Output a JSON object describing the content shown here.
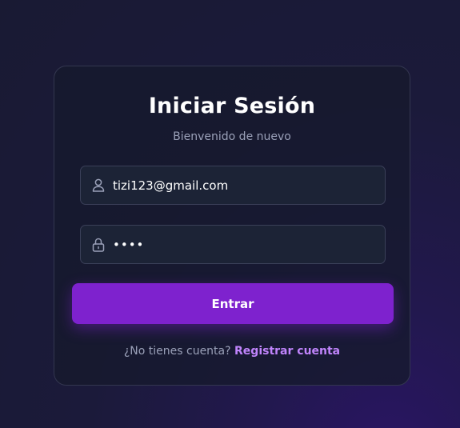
{
  "login": {
    "title": "Iniciar Sesión",
    "subtitle": "Bienvenido de nuevo",
    "email": {
      "icon": "user-icon",
      "value": "tizi123@gmail.com"
    },
    "password": {
      "icon": "lock-icon",
      "value": "••••"
    },
    "submit_label": "Entrar",
    "footer": {
      "prompt": "¿No tienes cuenta?",
      "link_label": "Registrar cuenta"
    }
  },
  "colors": {
    "accent": "#7e22ce",
    "link": "#c084fc",
    "card_bg": "#161a2d",
    "input_bg": "#1c2336"
  }
}
